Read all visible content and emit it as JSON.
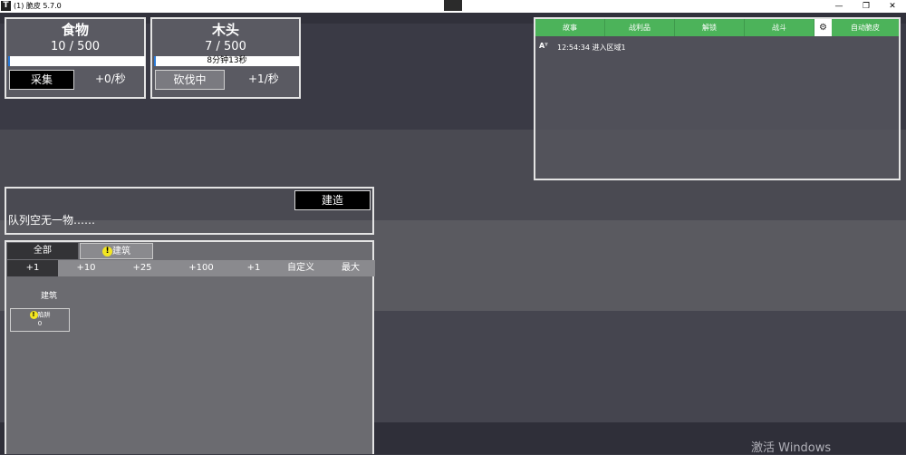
{
  "window": {
    "app_icon": "T",
    "title": "(1) 脆皮 5.7.0",
    "chevron_icon": "chevron-down-icon",
    "minimize": "—",
    "maximize": "❐",
    "close": "✕"
  },
  "resources": [
    {
      "name": "食物",
      "count": "10 / 500",
      "progress": 0.01,
      "progress_text": "",
      "action": "采集",
      "rate": "+0/秒"
    },
    {
      "name": "木头",
      "count": "7 / 500",
      "progress": 0.01,
      "progress_text": "8分钟13秒",
      "action": "砍伐中",
      "rate": "+1/秒"
    }
  ],
  "story": {
    "tabs": [
      "故事",
      "战利品",
      "解锁",
      "战斗"
    ],
    "settings_icon": "gear-icon",
    "auto_label": "自动脆皮",
    "font_icon": "Aᵀ",
    "log": [
      "12:54:34 进入区域1"
    ]
  },
  "queue": {
    "build_button": "建造",
    "empty_text": "队列空无一物……"
  },
  "build": {
    "tabs": [
      {
        "label": "全部",
        "warn": false
      },
      {
        "label": "建筑",
        "warn": true
      }
    ],
    "quantities": [
      "+1",
      "+10",
      "+25",
      "+100",
      "+1",
      "自定义",
      "最大"
    ],
    "section_title": "建筑",
    "items": [
      {
        "name": "陷阱",
        "count": "0",
        "warn": true
      }
    ]
  },
  "watermark": "激活 Windows",
  "colors": {
    "accent_green": "#4cb35a",
    "progress_blue": "#2a7ad8",
    "warn_yellow": "#f3e621"
  }
}
